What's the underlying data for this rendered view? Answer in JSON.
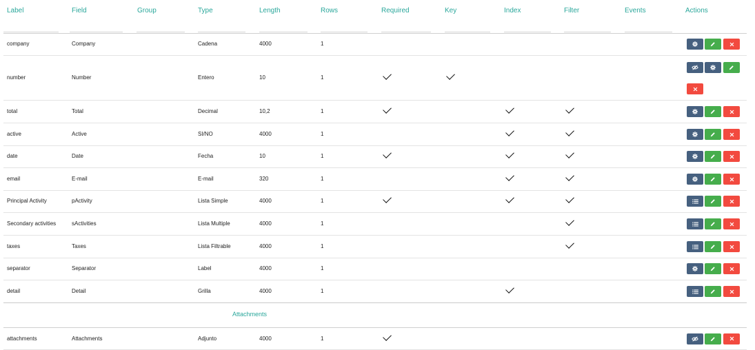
{
  "headers": [
    "Label",
    "Field",
    "Group",
    "Type",
    "Length",
    "Rows",
    "Required",
    "Key",
    "Index",
    "Filter",
    "Events",
    "Actions"
  ],
  "rows": [
    {
      "label": "company",
      "field": "Company",
      "group": "",
      "type": "Cadena",
      "length": "4000",
      "rows": "1",
      "required": false,
      "key": false,
      "index": false,
      "filter": false,
      "actions": [
        "settings",
        "edit",
        "delete"
      ]
    },
    {
      "label": "number",
      "field": "Number",
      "group": "",
      "type": "Entero",
      "length": "10",
      "rows": "1",
      "required": true,
      "key": true,
      "index": false,
      "filter": false,
      "actions": [
        "visibility-off",
        "settings",
        "edit",
        "delete"
      ]
    },
    {
      "label": "total",
      "field": "Total",
      "group": "",
      "type": "Decimal",
      "length": "10,2",
      "rows": "1",
      "required": true,
      "key": false,
      "index": true,
      "filter": true,
      "actions": [
        "settings",
        "edit",
        "delete"
      ]
    },
    {
      "label": "active",
      "field": "Active",
      "group": "",
      "type": "SI/NO",
      "length": "4000",
      "rows": "1",
      "required": false,
      "key": false,
      "index": true,
      "filter": true,
      "actions": [
        "settings",
        "edit",
        "delete"
      ]
    },
    {
      "label": "date",
      "field": "Date",
      "group": "",
      "type": "Fecha",
      "length": "10",
      "rows": "1",
      "required": true,
      "key": false,
      "index": true,
      "filter": true,
      "actions": [
        "settings",
        "edit",
        "delete"
      ]
    },
    {
      "label": "email",
      "field": "E-mail",
      "group": "",
      "type": "E-mail",
      "length": "320",
      "rows": "1",
      "required": false,
      "key": false,
      "index": true,
      "filter": true,
      "actions": [
        "settings",
        "edit",
        "delete"
      ]
    },
    {
      "label": "Principal Activity",
      "field": "pActivity",
      "group": "",
      "type": "Lista Simple",
      "length": "4000",
      "rows": "1",
      "required": true,
      "key": false,
      "index": true,
      "filter": true,
      "actions": [
        "list",
        "edit",
        "delete"
      ]
    },
    {
      "label": "Secondary activities",
      "field": "sActivities",
      "group": "",
      "type": "Lista Multiple",
      "length": "4000",
      "rows": "1",
      "required": false,
      "key": false,
      "index": false,
      "filter": true,
      "actions": [
        "list",
        "edit",
        "delete"
      ]
    },
    {
      "label": "taxes",
      "field": "Taxes",
      "group": "",
      "type": "Lista Filtrable",
      "length": "4000",
      "rows": "1",
      "required": false,
      "key": false,
      "index": false,
      "filter": true,
      "actions": [
        "list",
        "edit",
        "delete"
      ]
    },
    {
      "label": "separator",
      "field": "Separator",
      "group": "",
      "type": "Label",
      "length": "4000",
      "rows": "1",
      "required": false,
      "key": false,
      "index": false,
      "filter": false,
      "actions": [
        "settings",
        "edit",
        "delete"
      ]
    },
    {
      "label": "detail",
      "field": "Detail",
      "group": "",
      "type": "Grilla",
      "length": "4000",
      "rows": "1",
      "required": false,
      "key": false,
      "index": true,
      "filter": false,
      "actions": [
        "list",
        "edit",
        "delete"
      ]
    }
  ],
  "section": {
    "title": "Attachments"
  },
  "attachment_row": {
    "label": "attachments",
    "field": "Attachments",
    "group": "",
    "type": "Adjunto",
    "length": "4000",
    "rows": "1",
    "required": true,
    "key": false,
    "index": false,
    "filter": false,
    "actions": [
      "visibility-off",
      "edit",
      "delete"
    ]
  },
  "colors": {
    "accent": "#2aa79b",
    "button_dark": "#46607f",
    "button_edit": "#46ad4c",
    "button_delete": "#f24a3f"
  }
}
